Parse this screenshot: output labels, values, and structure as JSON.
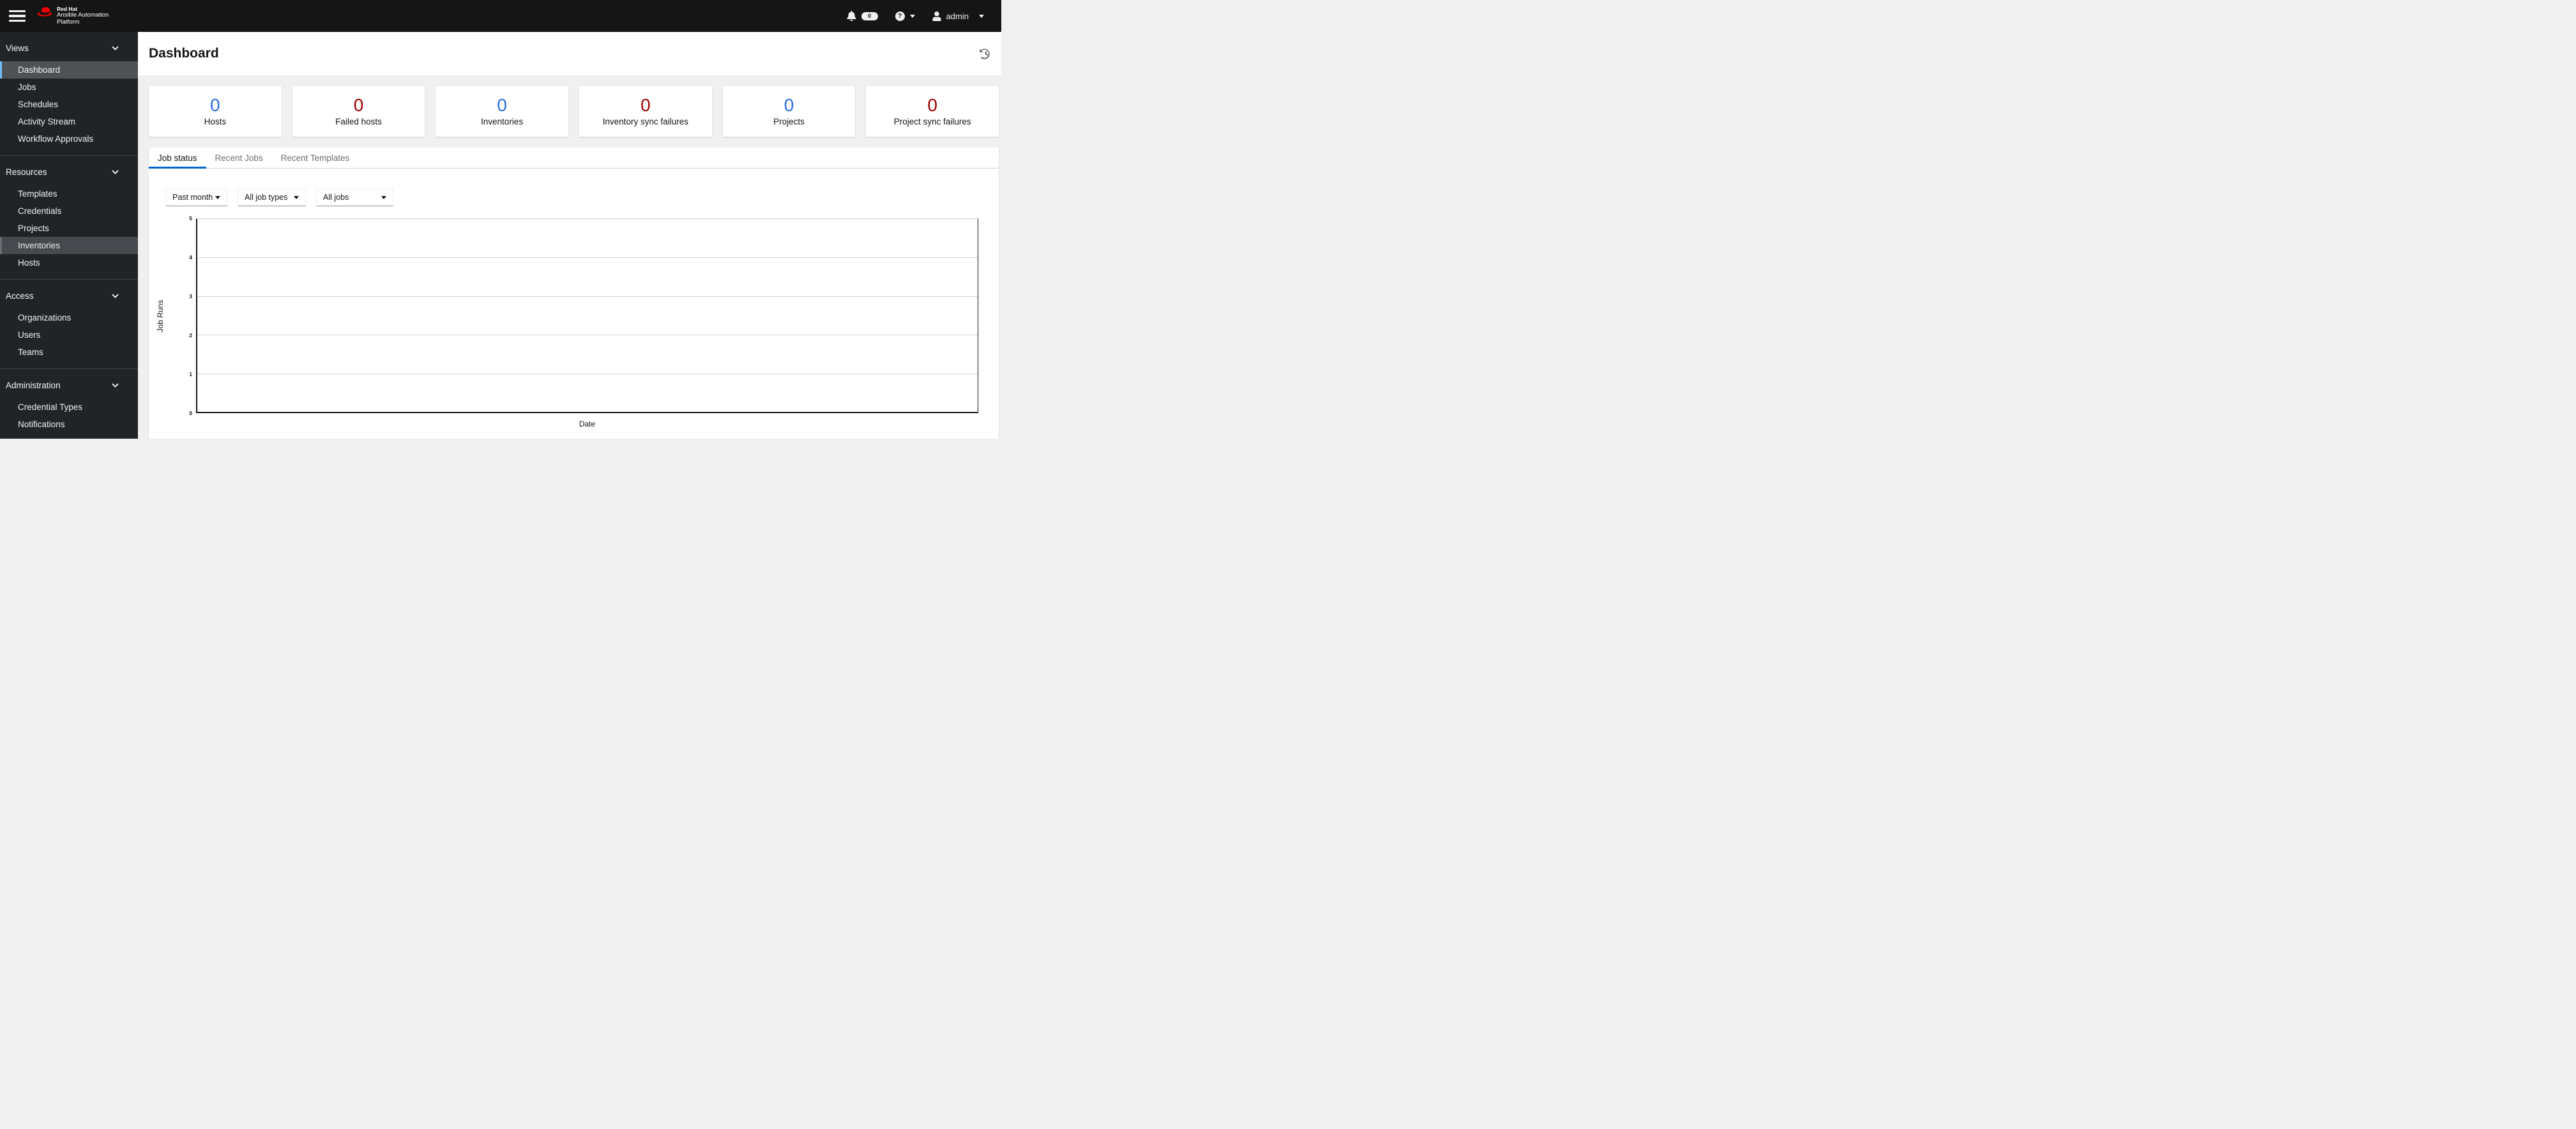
{
  "topbar": {
    "brand": {
      "line1": "Red Hat",
      "line2": "Ansible Automation",
      "line3": "Platform"
    },
    "notifications": {
      "count": "0"
    },
    "user": {
      "name": "admin"
    }
  },
  "sidebar": {
    "sections": [
      {
        "label": "Views",
        "items": [
          {
            "label": "Dashboard",
            "active": true
          },
          {
            "label": "Jobs",
            "active": false
          },
          {
            "label": "Schedules",
            "active": false
          },
          {
            "label": "Activity Stream",
            "active": false
          },
          {
            "label": "Workflow Approvals",
            "active": false
          }
        ]
      },
      {
        "label": "Resources",
        "items": [
          {
            "label": "Templates",
            "active": false
          },
          {
            "label": "Credentials",
            "active": false
          },
          {
            "label": "Projects",
            "active": false
          },
          {
            "label": "Inventories",
            "active": false,
            "highlighted": true
          },
          {
            "label": "Hosts",
            "active": false
          }
        ]
      },
      {
        "label": "Access",
        "items": [
          {
            "label": "Organizations",
            "active": false
          },
          {
            "label": "Users",
            "active": false
          },
          {
            "label": "Teams",
            "active": false
          }
        ]
      },
      {
        "label": "Administration",
        "items": [
          {
            "label": "Credential Types",
            "active": false
          },
          {
            "label": "Notifications",
            "active": false
          }
        ]
      }
    ]
  },
  "page": {
    "title": "Dashboard"
  },
  "stats": [
    {
      "value": "0",
      "label": "Hosts",
      "color": "#2b6de0"
    },
    {
      "value": "0",
      "label": "Failed hosts",
      "color": "#a30000"
    },
    {
      "value": "0",
      "label": "Inventories",
      "color": "#2b6de0"
    },
    {
      "value": "0",
      "label": "Inventory sync failures",
      "color": "#a30000"
    },
    {
      "value": "0",
      "label": "Projects",
      "color": "#2b6de0"
    },
    {
      "value": "0",
      "label": "Project sync failures",
      "color": "#a30000"
    }
  ],
  "tabs": [
    {
      "label": "Job status",
      "active": true
    },
    {
      "label": "Recent Jobs",
      "active": false
    },
    {
      "label": "Recent Templates",
      "active": false
    }
  ],
  "filters": {
    "period": {
      "value": "Past month"
    },
    "job_type": {
      "value": "All job types"
    },
    "job": {
      "value": "All jobs"
    }
  },
  "chart_data": {
    "type": "line",
    "title": "Job status",
    "xlabel": "Date",
    "ylabel": "Job Runs",
    "ylim": [
      0,
      5
    ],
    "yticks": [
      0,
      1,
      2,
      3,
      4,
      5
    ],
    "x": [],
    "series": [],
    "grid": "horizontal",
    "legend_position": "none"
  },
  "colors": {
    "topbar_bg": "#151515",
    "sidebar_bg": "#212427",
    "content_bg": "#f0f0f0",
    "accent_blue": "#0066cc",
    "active_nav_border": "#73bcf7",
    "stat_blue": "#2b6de0",
    "stat_red": "#a30000",
    "icon_gray": "#6a6e73"
  }
}
